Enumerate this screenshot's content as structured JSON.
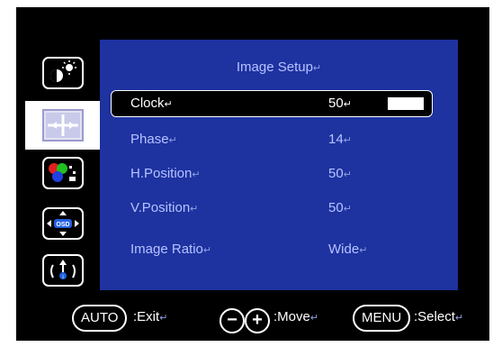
{
  "panel": {
    "title": "Image Setup",
    "return_mark": "↵"
  },
  "menu_icons": [
    {
      "name": "brightness-contrast-icon"
    },
    {
      "name": "image-setup-icon",
      "active": true
    },
    {
      "name": "color-setting-icon"
    },
    {
      "name": "osd-position-icon"
    },
    {
      "name": "reset-icon"
    }
  ],
  "rows": [
    {
      "label": "Clock",
      "value": "50",
      "selected": true,
      "bar_fraction": 0.5
    },
    {
      "label": "Phase",
      "value": "14"
    },
    {
      "label": "H.Position",
      "value": "50"
    },
    {
      "label": "V.Position",
      "value": "50"
    },
    {
      "label": "Image Ratio",
      "value": "Wide"
    }
  ],
  "footer": {
    "auto_key": "AUTO",
    "exit_label": "Exit",
    "minus_key": "−",
    "plus_key": "+",
    "move_label": "Move",
    "menu_key": "MENU",
    "select_label": "Select"
  },
  "colors": {
    "panel_bg": "#1e32a0",
    "text_light": "#b6c3ff",
    "osd_bg": "#000000",
    "highlight": "#ffffff"
  }
}
